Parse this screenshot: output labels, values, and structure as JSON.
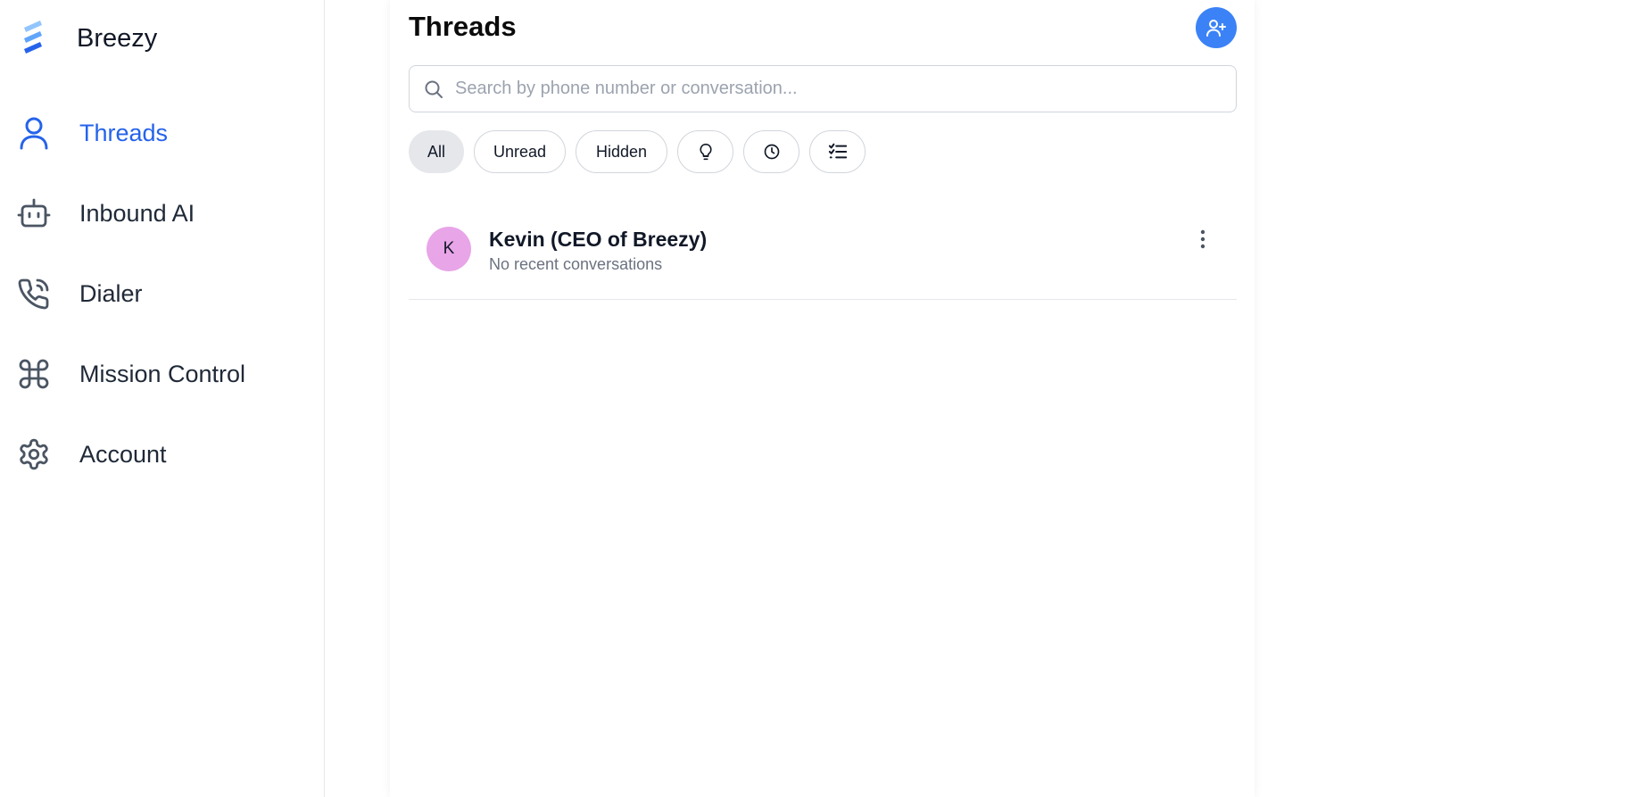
{
  "brand": {
    "name": "Breezy",
    "logo_icon": "breezy-logo-icon"
  },
  "sidebar": {
    "active_color": "#2563eb",
    "items": [
      {
        "label": "Threads",
        "icon": "user-icon",
        "active": true
      },
      {
        "label": "Inbound AI",
        "icon": "bot-icon",
        "active": false
      },
      {
        "label": "Dialer",
        "icon": "phone-icon",
        "active": false
      },
      {
        "label": "Mission Control",
        "icon": "command-icon",
        "active": false
      },
      {
        "label": "Account",
        "icon": "gear-icon",
        "active": false
      }
    ]
  },
  "main": {
    "title": "Threads",
    "add_contact_icon": "user-plus-icon",
    "accent_color": "#3b82f6",
    "search": {
      "placeholder": "Search by phone number or conversation...",
      "value": ""
    },
    "filters": [
      {
        "label": "All",
        "active": true
      },
      {
        "label": "Unread",
        "active": false
      },
      {
        "label": "Hidden",
        "active": false
      },
      {
        "icon": "lightbulb-icon"
      },
      {
        "icon": "clock-icon"
      },
      {
        "icon": "list-checks-icon"
      }
    ],
    "threads": [
      {
        "avatar_initial": "K",
        "avatar_color": "#e8a5e8",
        "name": "Kevin (CEO of Breezy)",
        "subtitle": "No recent conversations",
        "menu_icon": "more-vertical-icon"
      }
    ]
  }
}
